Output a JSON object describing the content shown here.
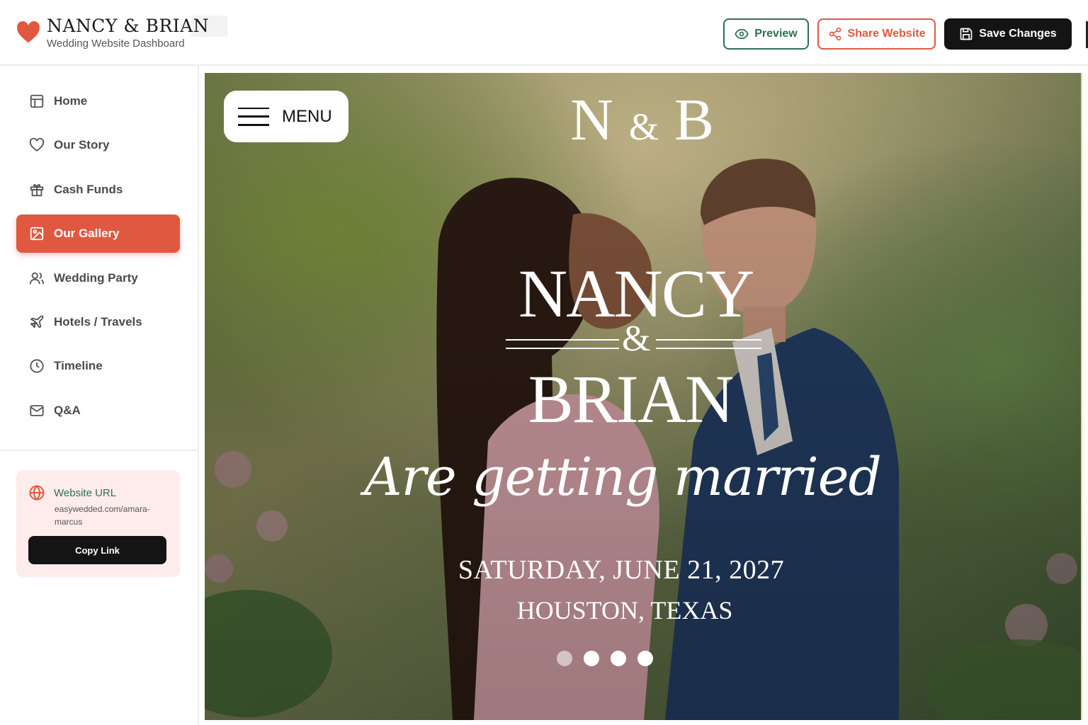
{
  "brand": {
    "title": "NANCY & BRIAN",
    "subtitle": "Wedding Website Dashboard",
    "icon": "heart-icon",
    "accent": "#e0583f"
  },
  "toolbar": {
    "preview_label": "Preview",
    "share_label": "Share Website",
    "save_label": "Save Changes"
  },
  "sidebar": {
    "items": [
      {
        "label": "Home",
        "icon": "layout-icon",
        "active": false
      },
      {
        "label": "Our Story",
        "icon": "heart-outline-icon",
        "active": false
      },
      {
        "label": "Cash Funds",
        "icon": "gift-icon",
        "active": false
      },
      {
        "label": "Our Gallery",
        "icon": "image-icon",
        "active": true
      },
      {
        "label": "Wedding Party",
        "icon": "users-icon",
        "active": false
      },
      {
        "label": "Hotels / Travels",
        "icon": "plane-icon",
        "active": false
      },
      {
        "label": "Timeline",
        "icon": "clock-icon",
        "active": false
      },
      {
        "label": "Q&A",
        "icon": "mail-icon",
        "active": false
      }
    ],
    "url_card": {
      "heading": "Website URL",
      "value": "easywedded.com/amara-marcus",
      "copy_label": "Copy Link"
    }
  },
  "hero": {
    "menu_label": "MENU",
    "monogram_left": "N",
    "monogram_amp": "&",
    "monogram_right": "B",
    "name_1": "NANCY",
    "amp": "&",
    "name_2": "BRIAN",
    "tagline": "Are getting married",
    "date": "SATURDAY, JUNE 21, 2027",
    "location": "HOUSTON, TEXAS",
    "slides_total": 4,
    "slide_active": 1
  },
  "colors": {
    "primary_green": "#2f6f4f",
    "accent_coral": "#e0583f",
    "dark": "#141414",
    "card_pink": "#fdeceb"
  }
}
